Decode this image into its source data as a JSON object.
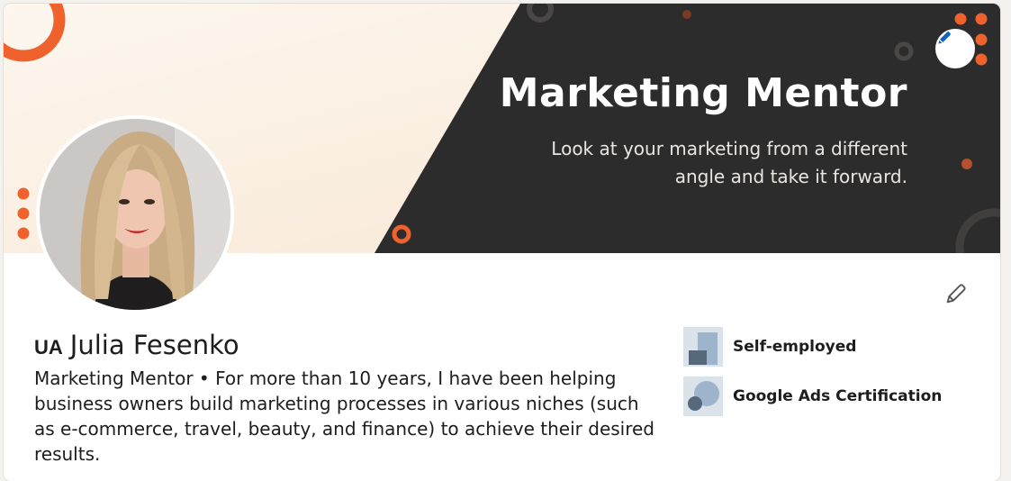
{
  "colors": {
    "accent": "#f0622d",
    "banner_dark": "#2d2c2c",
    "banner_light": "#fcf1e6",
    "edit_icon": "#0a66c2"
  },
  "banner": {
    "title": "Marketing Mentor",
    "subtitle_line1": "Look at your marketing from a different",
    "subtitle_line2": "angle and take it forward."
  },
  "profile": {
    "flag_code": "UA",
    "name": "Julia Fesenko",
    "headline": "Marketing Mentor • For more than 10 years, I have been helping business owners build marketing processes in various niches (such as e-commerce, travel, beauty, and finance) to achieve their desired results."
  },
  "side_panel": {
    "items": [
      {
        "label": "Self-employed",
        "icon": "company-logo-icon"
      },
      {
        "label": "Google Ads Certification",
        "icon": "education-logo-icon"
      }
    ]
  },
  "icons": {
    "banner_edit": "pencil-icon",
    "profile_edit": "pencil-icon"
  }
}
